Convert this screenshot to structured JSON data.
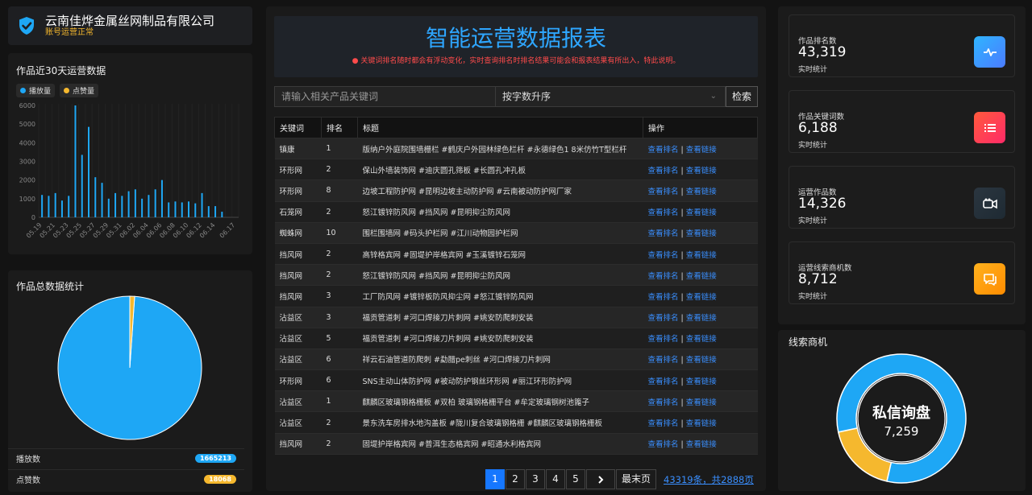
{
  "company": {
    "name": "云南佳烨金属丝网制品有限公司",
    "status": "账号运营正常"
  },
  "trend": {
    "title": "作品近30天运营数据",
    "legend": [
      {
        "label": "播放量",
        "color": "#1ea7f5"
      },
      {
        "label": "点赞量",
        "color": "#f5b82e"
      }
    ],
    "chart_data": {
      "type": "bar",
      "categories": [
        "05.19",
        "05.20",
        "05.21",
        "05.22",
        "05.23",
        "05.24",
        "05.25",
        "05.26",
        "05.27",
        "05.28",
        "05.29",
        "05.30",
        "05.31",
        "06.01",
        "06.02",
        "06.03",
        "06.04",
        "06.05",
        "06.06",
        "06.07",
        "06.08",
        "06.09",
        "06.10",
        "06.11",
        "06.12",
        "06.13",
        "06.14",
        "06.15",
        "06.16",
        "06.17"
      ],
      "x_tick_labels": [
        "05.19",
        "05.21",
        "05.23",
        "05.25",
        "05.27",
        "05.29",
        "05.31",
        "06.02",
        "06.04",
        "06.06",
        "06.08",
        "06.10",
        "06.12",
        "06.14",
        "06.17"
      ],
      "series": [
        {
          "name": "播放量",
          "values": [
            1200,
            1150,
            1300,
            900,
            1150,
            6000,
            3350,
            4850,
            2150,
            1850,
            1000,
            1300,
            1150,
            1400,
            1500,
            1000,
            1200,
            1500,
            2000,
            800,
            850,
            800,
            850,
            750,
            1300,
            600,
            600,
            300,
            0,
            0
          ]
        },
        {
          "name": "点赞量",
          "values": [
            0,
            0,
            0,
            0,
            0,
            0,
            0,
            0,
            0,
            0,
            0,
            0,
            0,
            0,
            0,
            0,
            0,
            0,
            0,
            0,
            0,
            0,
            0,
            0,
            0,
            0,
            0,
            0,
            0,
            0
          ]
        }
      ],
      "ylim": [
        0,
        6000
      ],
      "yticks": [
        0,
        1000,
        2000,
        3000,
        4000,
        5000,
        6000
      ]
    }
  },
  "totals": {
    "title": "作品总数据统计",
    "chart_data": {
      "type": "pie",
      "labels": [
        "播放量",
        "点赞量"
      ],
      "values": [
        1665213,
        18068
      ],
      "colors": [
        "#1ea7f5",
        "#f5b82e"
      ]
    },
    "rows": [
      {
        "label": "播放数",
        "value": "1665213",
        "color": "#1ea7f5"
      },
      {
        "label": "点赞数",
        "value": "18068",
        "color": "#f5b82e"
      }
    ]
  },
  "report": {
    "title": "智能运营数据报表",
    "notice": "● 关键词排名随时都会有浮动变化，实时查询排名时排名结果可能会和报表结果有所出入，特此说明。",
    "search_placeholder": "请输入相关产品关键词",
    "sort_value": "按字数升序",
    "search_button": "检索",
    "headers": [
      "关键词",
      "排名",
      "标题",
      "操作"
    ],
    "link_rank": "查看排名",
    "link_url": "查看链接",
    "rows": [
      {
        "kw": "镇康",
        "rank": "1",
        "title": "版纳户外庭院围墙栅栏 #鹤庆户外园林绿色栏杆 #永德绿色1 8米仿竹T型栏杆"
      },
      {
        "kw": "环形网",
        "rank": "2",
        "title": "保山外墙装饰网 #迪庆圆孔筛板 #长圆孔冲孔板"
      },
      {
        "kw": "环形网",
        "rank": "8",
        "title": "边坡工程防护网 #昆明边坡主动防护网 #云南被动防护网厂家"
      },
      {
        "kw": "石笼网",
        "rank": "2",
        "title": "怒江镀锌防风网 #挡风网 #昆明抑尘防风网"
      },
      {
        "kw": "蜘蛛网",
        "rank": "10",
        "title": "围栏围墙网 #码头护栏网 #江川动物园护栏网"
      },
      {
        "kw": "挡风网",
        "rank": "2",
        "title": "高锌格宾网 #固堤护岸格宾网 #玉溪镀锌石笼网"
      },
      {
        "kw": "挡风网",
        "rank": "2",
        "title": "怒江镀锌防风网 #挡风网 #昆明抑尘防风网"
      },
      {
        "kw": "挡风网",
        "rank": "3",
        "title": "工厂防风网 #镀锌板防风抑尘网 #怒江镀锌防风网"
      },
      {
        "kw": "沾益区",
        "rank": "3",
        "title": "福贡管道刺 #河口焊接刀片刺网 #姚安防爬刺安装"
      },
      {
        "kw": "沾益区",
        "rank": "5",
        "title": "福贡管道刺 #河口焊接刀片刺网 #姚安防爬刺安装"
      },
      {
        "kw": "沾益区",
        "rank": "6",
        "title": "祥云石油管道防爬刺 #勐腊pe刺丝 #河口焊接刀片刺网"
      },
      {
        "kw": "环形网",
        "rank": "6",
        "title": "SNS主动山体防护网 #被动防护钢丝环形网 #丽江环形防护网"
      },
      {
        "kw": "沾益区",
        "rank": "1",
        "title": "麒麟区玻璃钢格栅板 #双柏 玻璃钢格栅平台 #牟定玻璃钢树池篦子"
      },
      {
        "kw": "沾益区",
        "rank": "2",
        "title": "景东洗车房排水地沟盖板 #陇川复合玻璃钢格栅 #麒麟区玻璃钢格栅板"
      },
      {
        "kw": "挡风网",
        "rank": "2",
        "title": "固堤护岸格宾网 #普洱生态格宾网 #昭通水利格宾网"
      }
    ],
    "pager": {
      "pages": [
        "1",
        "2",
        "3",
        "4",
        "5"
      ],
      "active": "1",
      "next_icon": "chevron-right-icon",
      "last": "最末页",
      "info": "43319条，共2888页"
    }
  },
  "kpis": [
    {
      "label": "作品排名数",
      "value": "43,319",
      "sub": "实时统计",
      "icon": "pulse-icon",
      "grad": [
        "#2fb5ff",
        "#4b7bff"
      ]
    },
    {
      "label": "作品关键词数",
      "value": "6,188",
      "sub": "实时统计",
      "icon": "list-icon",
      "grad": [
        "#ff5a3c",
        "#ff2a68"
      ]
    },
    {
      "label": "运营作品数",
      "value": "14,326",
      "sub": "实时统计",
      "icon": "video-camera-icon",
      "grad": [
        "#2b3640",
        "#1e2a33"
      ]
    },
    {
      "label": "运营线索商机数",
      "value": "8,712",
      "sub": "实时统计",
      "icon": "chat-icon",
      "grad": [
        "#ffb21e",
        "#ff8c00"
      ]
    }
  ],
  "leads": {
    "title": "线索商机",
    "center_label": "私信询盘",
    "center_value": "7,259",
    "chart_data": {
      "type": "pie",
      "values": [
        82,
        18
      ],
      "colors": [
        "#1ea7f5",
        "#f5b82e"
      ]
    }
  }
}
